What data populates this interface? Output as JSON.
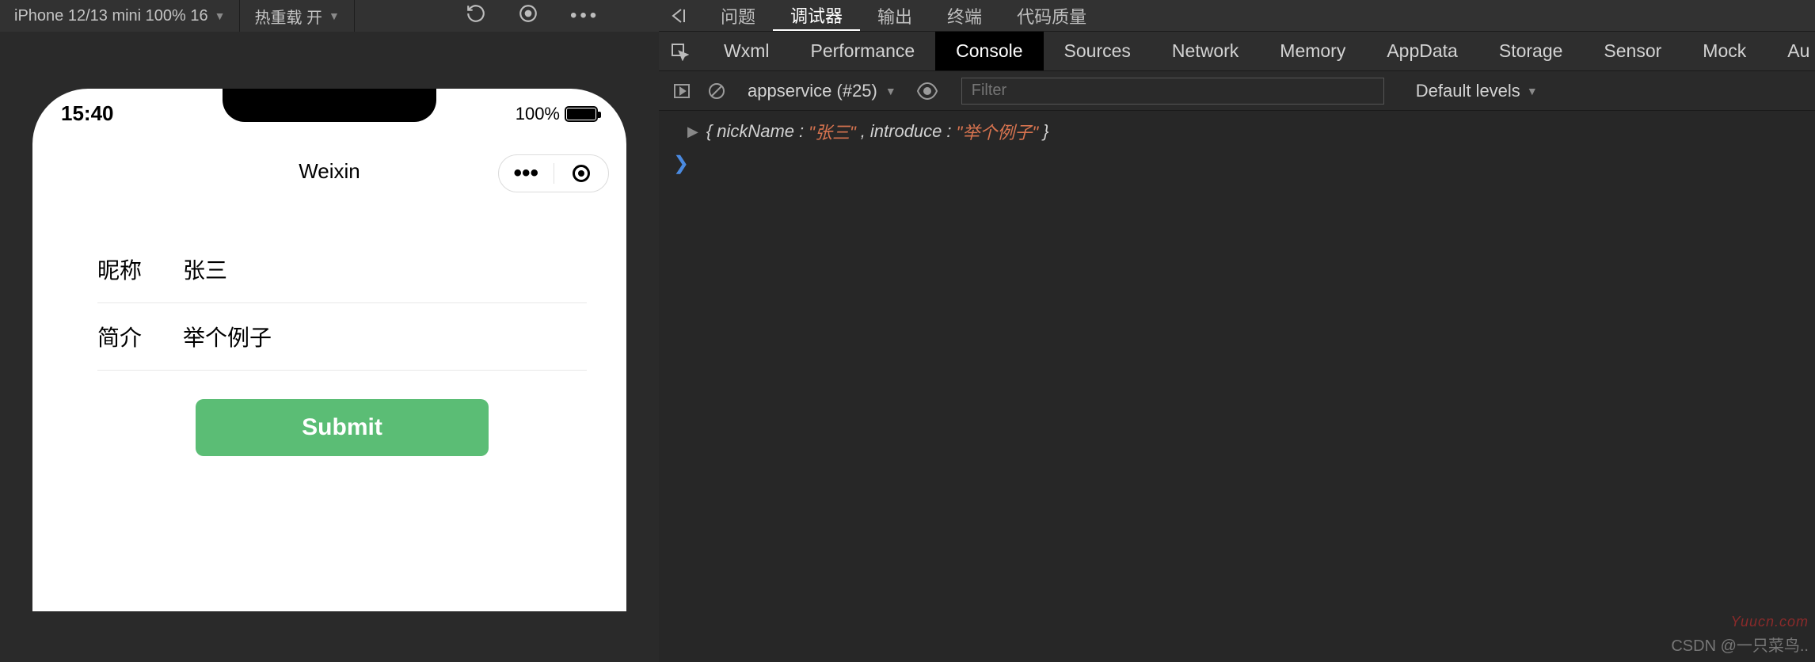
{
  "toolbar": {
    "device": "iPhone 12/13 mini 100% 16",
    "hotreload": "热重载 开"
  },
  "phone": {
    "time": "15:40",
    "battery_pct": "100%",
    "app_title": "Weixin",
    "form": {
      "nickname_label": "昵称",
      "nickname_value": "张三",
      "intro_label": "简介",
      "intro_value": "举个例子",
      "submit": "Submit"
    }
  },
  "devtools": {
    "top_tabs": [
      "问题",
      "调试器",
      "输出",
      "终端",
      "代码质量"
    ],
    "top_active": "调试器",
    "sub_tabs": [
      "Wxml",
      "Performance",
      "Console",
      "Sources",
      "Network",
      "Memory",
      "AppData",
      "Storage",
      "Sensor",
      "Mock",
      "Au"
    ],
    "sub_active": "Console",
    "context": "appservice (#25)",
    "filter_placeholder": "Filter",
    "levels": "Default levels",
    "log": {
      "key1": "nickName",
      "val1": "\"张三\"",
      "key2": "introduce",
      "val2": "\"举个例子\""
    }
  },
  "watermarks": {
    "w1": "Yuucn.com",
    "w2": "CSDN @一只菜鸟.."
  }
}
